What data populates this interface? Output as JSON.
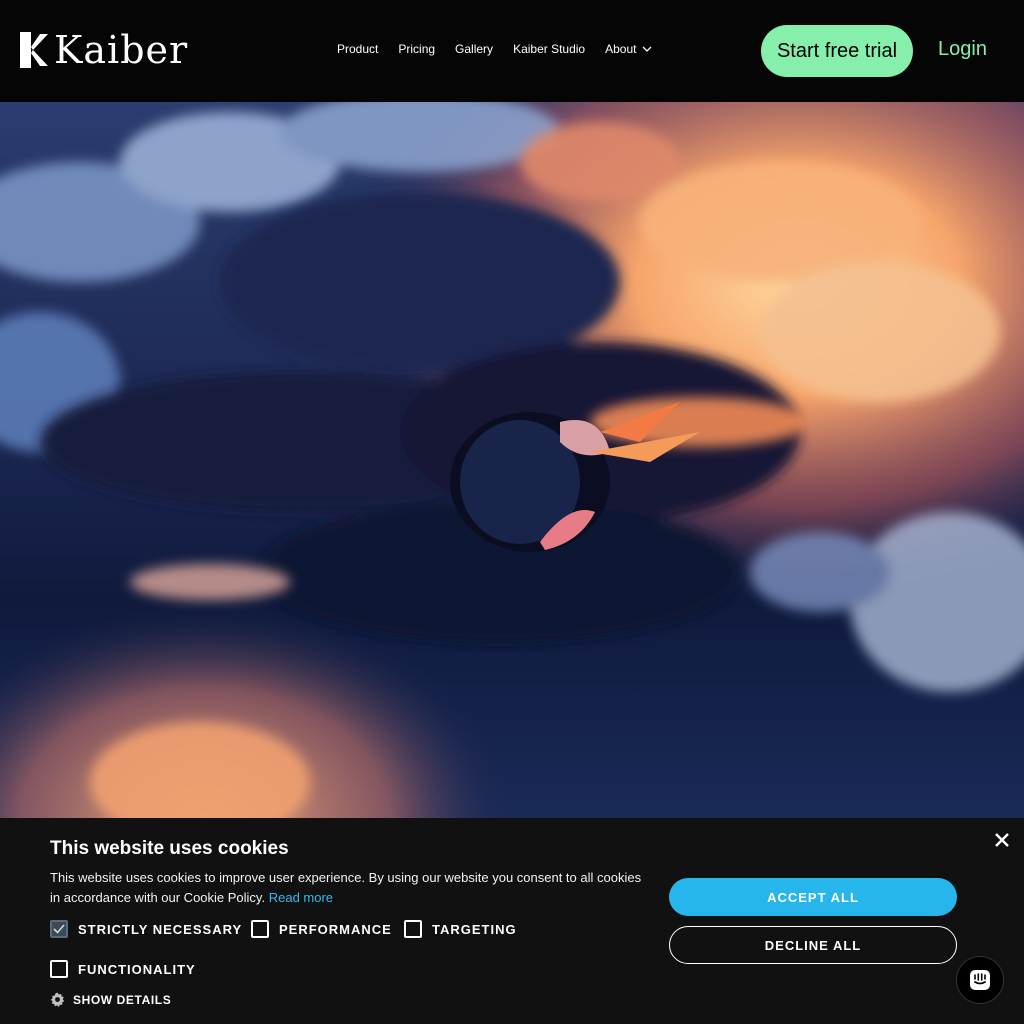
{
  "header": {
    "brand_name": "Kaiber",
    "nav": [
      {
        "label": "Product"
      },
      {
        "label": "Pricing"
      },
      {
        "label": "Gallery"
      },
      {
        "label": "Kaiber Studio"
      },
      {
        "label": "About"
      }
    ],
    "cta_label": "Start free trial",
    "login_label": "Login"
  },
  "cookie_banner": {
    "title": "This website uses cookies",
    "text": "This website uses cookies to improve user experience. By using our website you consent to all cookies in accordance with our Cookie Policy.",
    "read_more_label": "Read more",
    "options": [
      {
        "label": "STRICTLY NECESSARY",
        "checked": true
      },
      {
        "label": "PERFORMANCE",
        "checked": false
      },
      {
        "label": "TARGETING",
        "checked": false
      },
      {
        "label": "FUNCTIONALITY",
        "checked": false
      }
    ],
    "show_details_label": "SHOW DETAILS",
    "accept_label": "ACCEPT ALL",
    "decline_label": "DECLINE ALL"
  },
  "colors": {
    "accent_green": "#86efac",
    "accept_blue": "#26b6ec",
    "banner_bg": "#111111",
    "header_bg": "#050505"
  },
  "icons": {
    "logo": "kaiber-k-logo-icon",
    "about_dropdown": "chevron-down-icon",
    "close": "close-icon",
    "show_details": "gear-icon",
    "chat": "chat-icon",
    "checkbox_checked": "checkmark-icon"
  }
}
